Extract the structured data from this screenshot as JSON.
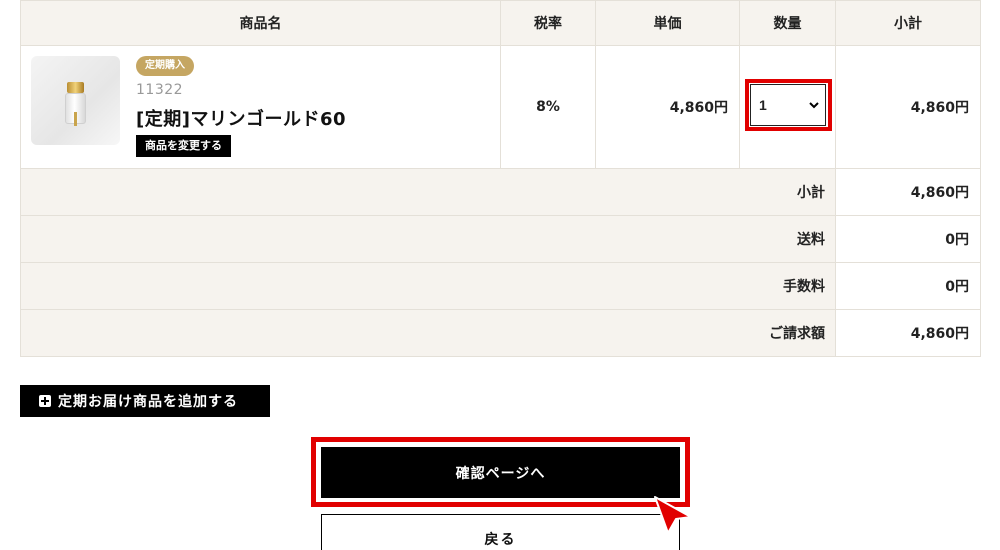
{
  "table": {
    "headers": {
      "product": "商品名",
      "tax_rate": "税率",
      "unit_price": "単価",
      "quantity": "数量",
      "subtotal": "小計"
    },
    "item": {
      "badge": "定期購入",
      "code": "11322",
      "name": "[定期]マリンゴールド60",
      "change_label": "商品を変更する",
      "thumbnail_icon": "supplement-bottle-icon",
      "tax_rate": "8%",
      "unit_price": "4,860円",
      "quantity": "1",
      "subtotal": "4,860円"
    },
    "summary": [
      {
        "label": "小計",
        "value": "4,860円"
      },
      {
        "label": "送料",
        "value": "0円"
      },
      {
        "label": "手数料",
        "value": "0円"
      },
      {
        "label": "ご請求額",
        "value": "4,860円"
      }
    ]
  },
  "actions": {
    "add_label": "定期お届け商品を追加する",
    "confirm_label": "確認ページへ",
    "back_label": "戻る"
  },
  "colors": {
    "header_bg": "#f6f3ee",
    "badge_bg": "#c5a662",
    "highlight": "#e10000",
    "button_bg": "#000000"
  }
}
